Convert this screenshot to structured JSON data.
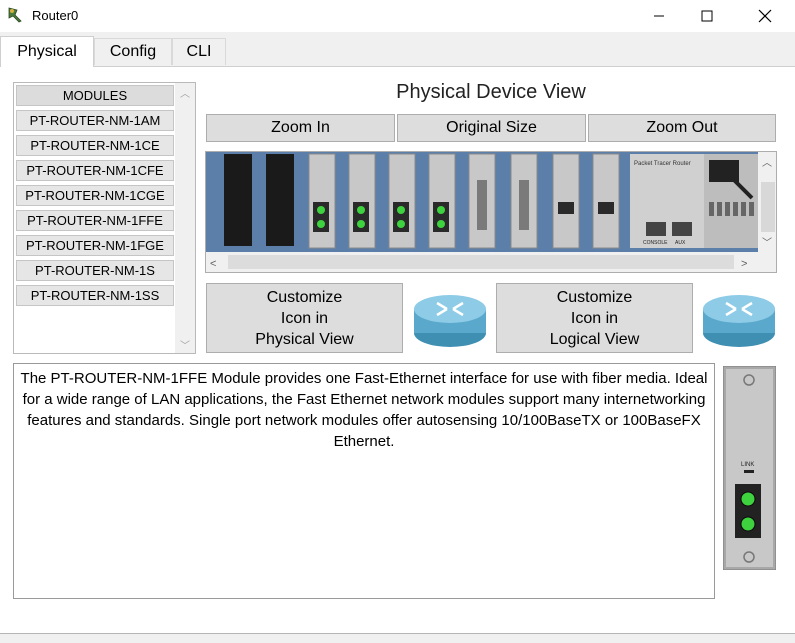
{
  "window": {
    "title": "Router0",
    "minimize": "—",
    "maximize": "☐",
    "close": "✕"
  },
  "tabs": [
    {
      "label": "Physical",
      "active": true
    },
    {
      "label": "Config"
    },
    {
      "label": "CLI"
    }
  ],
  "modules": {
    "header": "MODULES",
    "items": [
      "PT-ROUTER-NM-1AM",
      "PT-ROUTER-NM-1CE",
      "PT-ROUTER-NM-1CFE",
      "PT-ROUTER-NM-1CGE",
      "PT-ROUTER-NM-1FFE",
      "PT-ROUTER-NM-1FGE",
      "PT-ROUTER-NM-1S",
      "PT-ROUTER-NM-1SS"
    ],
    "selected": "PT-ROUTER-NM-1FFE"
  },
  "physical_view": {
    "title": "Physical Device View",
    "zoom_in": "Zoom In",
    "original_size": "Original Size",
    "zoom_out": "Zoom Out",
    "device_brand": "Packet Tracer Router",
    "port_labels": [
      "CONSOLE",
      "AUX"
    ]
  },
  "customize": {
    "physical": [
      "Customize",
      "Icon in",
      "Physical View"
    ],
    "logical": [
      "Customize",
      "Icon in",
      "Logical View"
    ]
  },
  "description": "The PT-ROUTER-NM-1FFE Module provides one Fast-Ethernet interface for use with fiber media. Ideal for a wide range of LAN applications, the Fast Ethernet network modules support many internetworking features and standards. Single port network modules offer autosensing 10/100BaseTX or 100BaseFX Ethernet.",
  "module_preview": {
    "label": "LINK"
  },
  "colors": {
    "chassis": "#5b7fa8",
    "slot": "#c8c8c8",
    "port_green": "#3fd23f",
    "router_icon": "#6bb7d6"
  }
}
